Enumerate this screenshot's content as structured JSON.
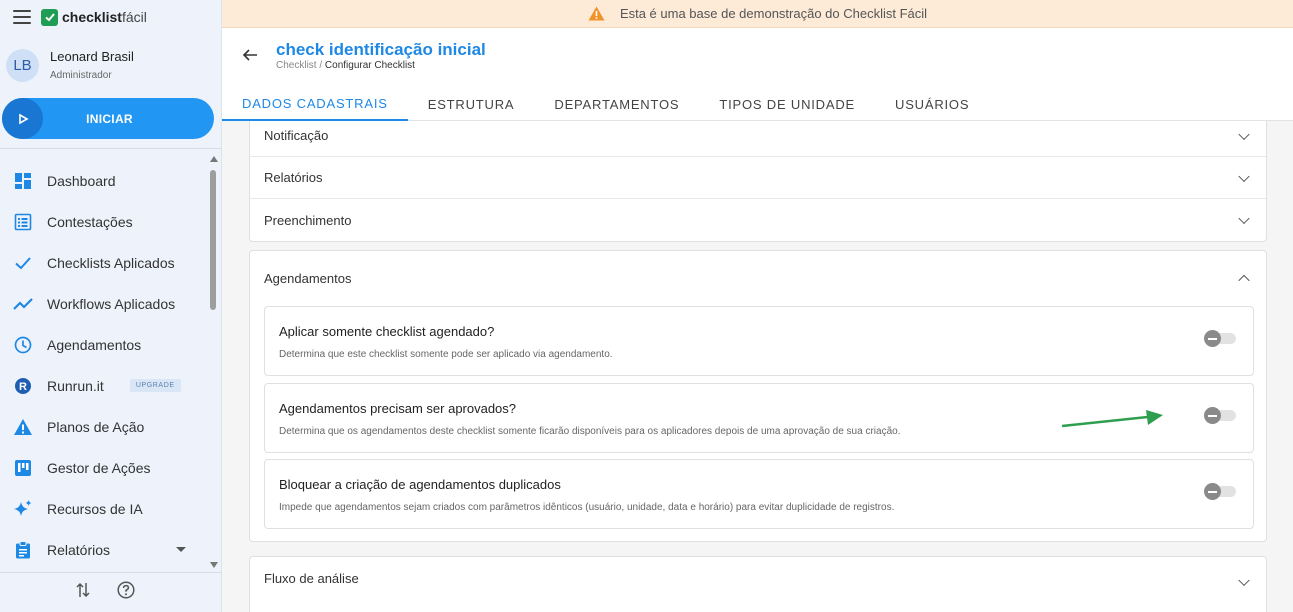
{
  "app": {
    "logo_bold": "checklist",
    "logo_light": "fácil"
  },
  "user": {
    "initials": "LB",
    "name": "Leonard Brasil",
    "role": "Administrador"
  },
  "start_button": {
    "label": "INICIAR"
  },
  "nav": [
    {
      "label": "Dashboard",
      "icon": "dashboard-icon"
    },
    {
      "label": "Contestações",
      "icon": "list-icon"
    },
    {
      "label": "Checklists Aplicados",
      "icon": "check-icon"
    },
    {
      "label": "Workflows Aplicados",
      "icon": "trending-icon"
    },
    {
      "label": "Agendamentos",
      "icon": "clock-icon"
    },
    {
      "label": "Runrun.it",
      "icon": "runrun-icon",
      "badge": "UPGRADE"
    },
    {
      "label": "Planos de Ação",
      "icon": "warning-icon"
    },
    {
      "label": "Gestor de Ações",
      "icon": "kanban-icon"
    },
    {
      "label": "Recursos de IA",
      "icon": "sparkle-icon"
    },
    {
      "label": "Relatórios",
      "icon": "clipboard-icon"
    }
  ],
  "banner": {
    "text": "Esta é uma base de demonstração do Checklist Fácil"
  },
  "header": {
    "title": "check identificação inicial",
    "breadcrumb_parent": "Checklist",
    "breadcrumb_sep": " / ",
    "breadcrumb_current": "Configurar Checklist",
    "tabs": [
      "DADOS CADASTRAIS",
      "ESTRUTURA",
      "DEPARTAMENTOS",
      "TIPOS DE UNIDADE",
      "USUÁRIOS"
    ],
    "active_tab": 0
  },
  "sections_top": [
    "Notificação",
    "Relatórios",
    "Preenchimento"
  ],
  "agendamentos": {
    "title": "Agendamentos",
    "options": [
      {
        "title": "Aplicar somente checklist agendado?",
        "desc": "Determina que este checklist somente pode ser aplicado via agendamento.",
        "enabled": false
      },
      {
        "title": "Agendamentos precisam ser aprovados?",
        "desc": "Determina que os agendamentos deste checklist somente ficarão disponíveis para os aplicadores depois de uma aprovação de sua criação.",
        "enabled": false
      },
      {
        "title": "Bloquear a criação de agendamentos duplicados",
        "desc": "Impede que agendamentos sejam criados com parâmetros idênticos (usuário, unidade, data e horário) para evitar duplicidade de registros.",
        "enabled": false
      }
    ]
  },
  "sections_bottom": [
    "Fluxo de análise"
  ],
  "colors": {
    "accent": "#1e88e5",
    "start": "#2196f3",
    "banner_bg": "#fdebd8",
    "warning": "#f0932b",
    "arrow": "#2e9e4f"
  }
}
